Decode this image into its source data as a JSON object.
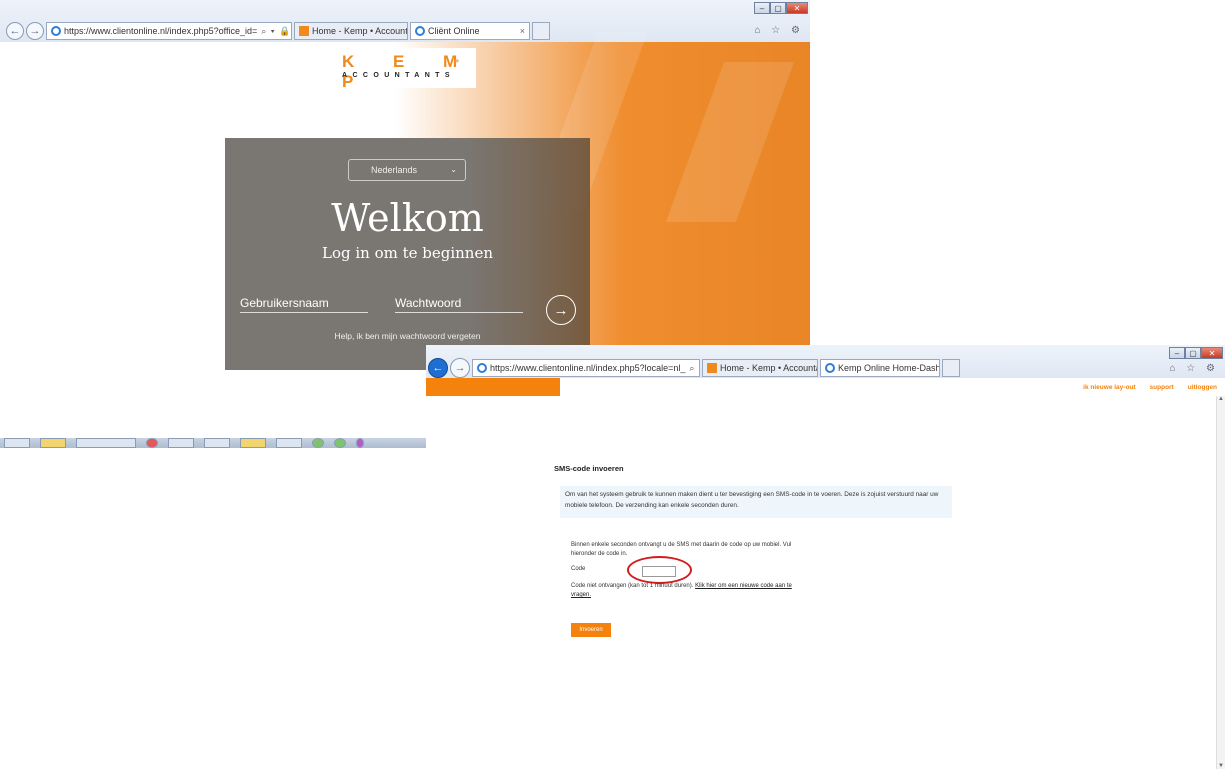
{
  "browser1": {
    "address": "https://www.clientonline.nl/index.php5?office_id=",
    "tabs": [
      {
        "label": "Home - Kemp • Accountants",
        "favicon": "kemp"
      },
      {
        "label": "Cliënt Online",
        "favicon": "ie",
        "close": "×"
      }
    ],
    "window_buttons": {
      "minimize": "–",
      "maximize": "▢",
      "close": "✕"
    },
    "tools": "⌂ ☆ ⚙"
  },
  "kemp": {
    "logo_main": "K E M P",
    "logo_dot": "•",
    "logo_sub": "ACCOUNTANTS",
    "language": "Nederlands",
    "welcome": "Welkom",
    "subtitle": "Log in om te beginnen",
    "username_placeholder": "Gebruikersnaam",
    "password_placeholder": "Wachtwoord",
    "submit_arrow": "→",
    "forgot": "Help, ik ben mijn wachtwoord vergeten",
    "accent_color": "#f08a1c"
  },
  "browser2": {
    "address": "https://www.clientonline.nl/index.php5?locale=nl_",
    "tabs": [
      {
        "label": "Home - Kemp • Accountants",
        "favicon": "kemp"
      },
      {
        "label": "Kemp Online Home-Dashb...",
        "favicon": "ie",
        "close": "×"
      }
    ],
    "toplinks": [
      "ik nieuwe lay-out",
      "support",
      "uitloggen"
    ]
  },
  "sms": {
    "title": "SMS-code invoeren",
    "info": "Om van het systeem gebruik te kunnen maken dient u ter bevestiging een SMS-code in te voeren. Deze is zojuist verstuurd naar uw mobiele telefoon. De verzending kan enkele seconden duren.",
    "message": "Binnen enkele seconden ontvangt u de SMS met daarin de code op uw mobiel. Vul hieronder de code in.",
    "code_label": "Code",
    "code_value": "",
    "not_received_prefix": "Code niet ontvangen (kan tot 1 minuut duren).",
    "not_received_link": "Klik hier om een nieuwe code aan te vragen.",
    "submit_label": "Invoeren",
    "accent_color": "#f5820d"
  }
}
